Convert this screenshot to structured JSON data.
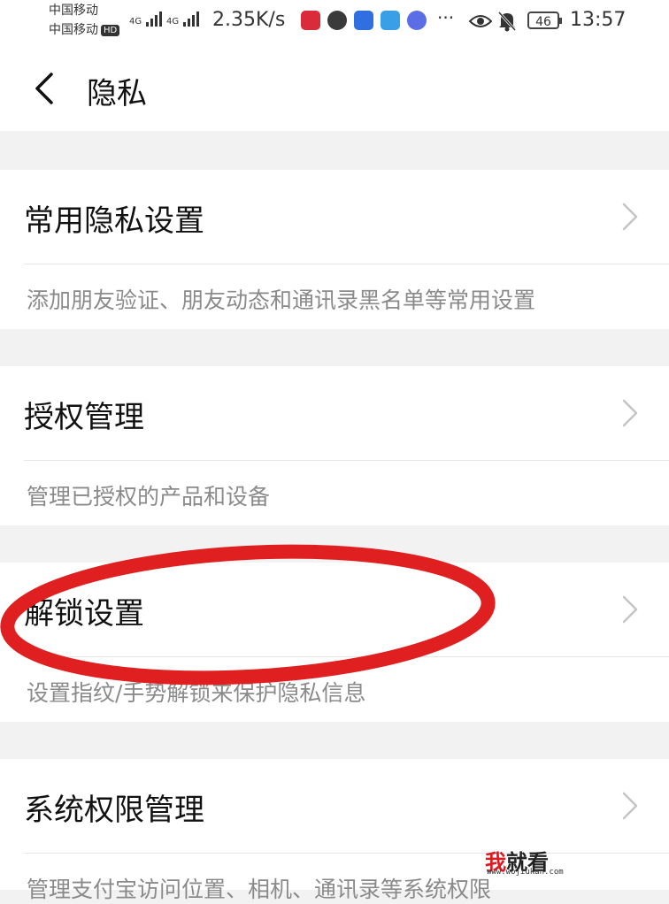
{
  "status_bar": {
    "carrier_1": "中国移动",
    "carrier_2": "中国移动",
    "hd_badge": "HD",
    "network_1": "4G",
    "network_2": "4G",
    "speed": "2.35K/s",
    "battery": "46",
    "time": "13:57",
    "more": "···",
    "icons": [
      "signal-bars-icon",
      "app-icon-red",
      "app-icon-dark",
      "app-icon-blue",
      "app-icon-weather",
      "app-icon-music",
      "eye-icon",
      "mute-bell-icon",
      "battery-icon"
    ]
  },
  "header": {
    "back_icon": "chevron-left-icon",
    "title": "隐私"
  },
  "sections": [
    {
      "label": "常用隐私设置",
      "description": "添加朋友验证、朋友动态和通讯录黑名单等常用设置"
    },
    {
      "label": "授权管理",
      "description": "管理已授权的产品和设备"
    },
    {
      "label": "解锁设置",
      "description": "设置指纹/手势解锁来保护隐私信息"
    },
    {
      "label": "系统权限管理",
      "description": "管理支付宝访问位置、相机、通讯录等系统权限"
    }
  ],
  "annotation": {
    "color": "#e02020",
    "shape": "red-ellipse-around-解锁设置"
  },
  "watermark": {
    "text_red": "我",
    "text_black": "就看",
    "url": "www.wojiukan.com"
  },
  "colors": {
    "background": "#f2f2f2",
    "card": "#ffffff",
    "primary_text": "#111111",
    "secondary_text": "#8a8a8a",
    "chevron": "#c4c4c4"
  }
}
